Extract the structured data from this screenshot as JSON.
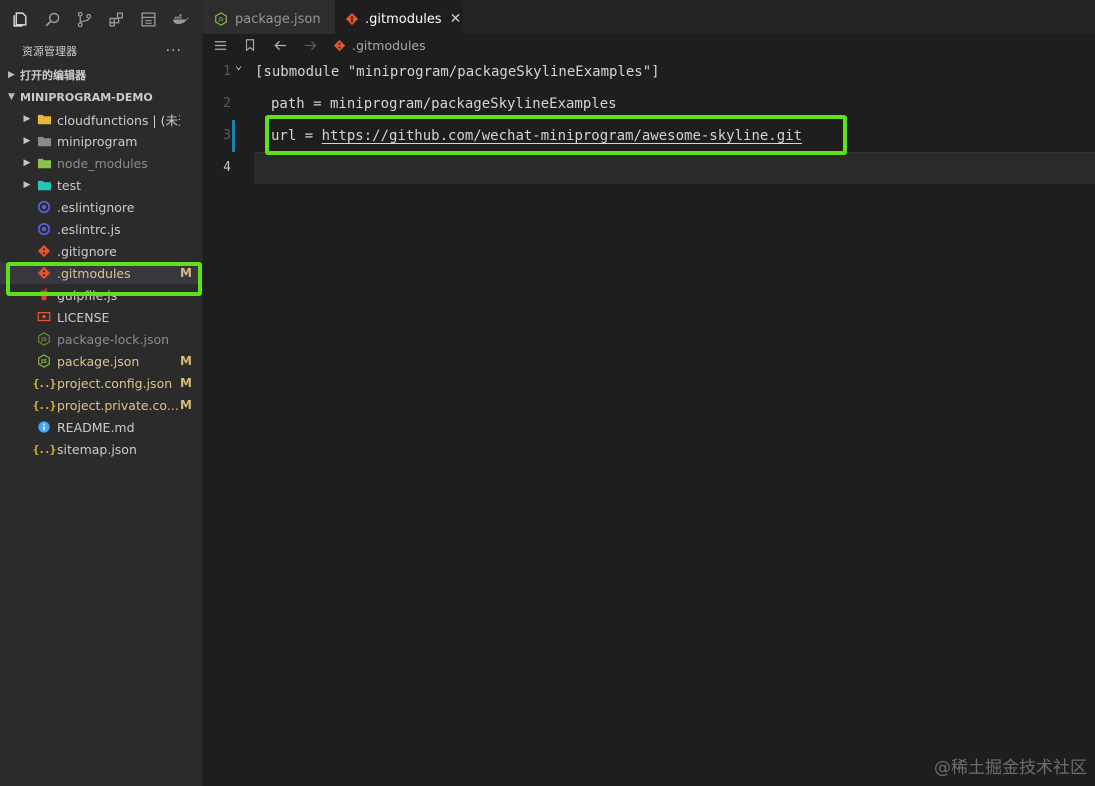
{
  "toolbar": {
    "icons": [
      "explorer-icon",
      "search-icon",
      "source-control-icon",
      "extensions-icon",
      "remote-icon",
      "docker-icon"
    ]
  },
  "sidebar": {
    "title": "资源管理器",
    "more": "···",
    "open_editors_label": "打开的编辑器",
    "project_label": "MINIPROGRAM-DEMO",
    "items": [
      {
        "name": "cloudfunctions | (未选...",
        "type": "folder",
        "icon_color": "#e8b73b",
        "expandable": true,
        "dim": false,
        "modified": false,
        "badge": ""
      },
      {
        "name": "miniprogram",
        "type": "folder",
        "icon_color": "#8a8a8a",
        "expandable": true,
        "dim": false,
        "modified": false,
        "badge": ""
      },
      {
        "name": "node_modules",
        "type": "folder",
        "icon_color": "#8bc34a",
        "expandable": true,
        "dim": true,
        "modified": false,
        "badge": ""
      },
      {
        "name": "test",
        "type": "folder",
        "icon_color": "#26c6b5",
        "expandable": true,
        "dim": false,
        "modified": false,
        "badge": ""
      },
      {
        "name": ".eslintignore",
        "type": "eslint",
        "icon_color": "#5b5fd6",
        "expandable": false,
        "dim": false,
        "modified": false,
        "badge": ""
      },
      {
        "name": ".eslintrc.js",
        "type": "eslint",
        "icon_color": "#5b5fd6",
        "expandable": false,
        "dim": false,
        "modified": false,
        "badge": ""
      },
      {
        "name": ".gitignore",
        "type": "git",
        "icon_color": "#e4532e",
        "expandable": false,
        "dim": false,
        "modified": false,
        "badge": ""
      },
      {
        "name": ".gitmodules",
        "type": "git",
        "icon_color": "#e4532e",
        "expandable": false,
        "dim": false,
        "modified": true,
        "badge": "M",
        "selected": true
      },
      {
        "name": "gulpfile.js",
        "type": "gulp",
        "icon_color": "#e53935",
        "expandable": false,
        "dim": false,
        "modified": false,
        "badge": ""
      },
      {
        "name": "LICENSE",
        "type": "license",
        "icon_color": "#e4532e",
        "expandable": false,
        "dim": false,
        "modified": false,
        "badge": ""
      },
      {
        "name": "package-lock.json",
        "type": "node",
        "icon_color": "#6d8f3b",
        "expandable": false,
        "dim": true,
        "modified": false,
        "badge": ""
      },
      {
        "name": "package.json",
        "type": "node",
        "icon_color": "#8bc34a",
        "expandable": false,
        "dim": false,
        "modified": true,
        "badge": "M"
      },
      {
        "name": "project.config.json",
        "type": "json",
        "icon_color": "#e8b73b",
        "expandable": false,
        "dim": false,
        "modified": true,
        "badge": "M"
      },
      {
        "name": "project.private.co...",
        "type": "json",
        "icon_color": "#e8b73b",
        "expandable": false,
        "dim": false,
        "modified": true,
        "badge": "M"
      },
      {
        "name": "README.md",
        "type": "info",
        "icon_color": "#42a5f5",
        "expandable": false,
        "dim": false,
        "modified": false,
        "badge": ""
      },
      {
        "name": "sitemap.json",
        "type": "json",
        "icon_color": "#e8b73b",
        "expandable": false,
        "dim": false,
        "modified": false,
        "badge": ""
      }
    ]
  },
  "tabs": [
    {
      "label": "package.json",
      "active": false
    },
    {
      "label": ".gitmodules",
      "active": true,
      "close": "✕"
    }
  ],
  "breadcrumb": {
    "file": ".gitmodules"
  },
  "editor": {
    "lines": [
      {
        "num": "1",
        "text": "[submodule \"miniprogram/packageSkylineExamples\"]"
      },
      {
        "num": "2",
        "text": "path = miniprogram/packageSkylineExamples"
      },
      {
        "num": "3",
        "prefix": "url = ",
        "link": "https://github.com/wechat-miniprogram/awesome-skyline.git"
      },
      {
        "num": "4",
        "text": ""
      }
    ]
  },
  "watermark": "@稀土掘金技术社区",
  "colors": {
    "highlight": "#5ee01b",
    "modified": "#e2c08d",
    "accent": "#1b81a8"
  }
}
